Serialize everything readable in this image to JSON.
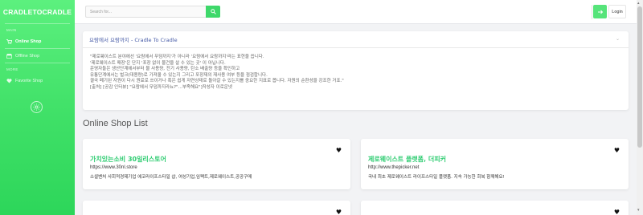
{
  "sidebar": {
    "brand": "CRADLETOCRADLE",
    "section_main": "Main",
    "items": [
      {
        "label": "Online Shop",
        "icon": "cart-icon"
      },
      {
        "label": "Offline Shop",
        "icon": "store-icon"
      }
    ],
    "section_more": "More",
    "extra_items": [
      {
        "label": "Favorite Shop",
        "icon": "heart-icon"
      }
    ]
  },
  "topbar": {
    "search_placeholder": "Search for...",
    "login_label": "Login"
  },
  "info_card": {
    "title": "요람에서 요람까지 - Cradle To Cradle",
    "lines": [
      "\"제로웨이스트 분야에선 '요람에서 무덤까지'가 아니라 '요람에서 요람까지'라는 표현을 씁니다.",
      "'제로웨이스트 매장'은 단지 '포장 없이 물건을 살 수 있는 곳' 이 아닙니다.",
      "운영자들은 생산단계에서부터 물 사용량, 전기 사용량, 탄소 배출량 등을 확인하고",
      "유통단계에서는 벌크(대용량)로 가져올 수 있는지 그리고 포장재의 재사용 여부 등을 점검합니다.",
      "결국 폐기된 자원이 다시 원료로 쓰이거나 혹은 쉽게 자연상태로 돌아갈 수 있는지를 중요한 지표로 봅니다. 자원의 순환성을 강조한 거죠.\"",
      "[출처] [공감 인터뷰] \"요람에서 무덤까지라뇨?\"...부족해요\"]작성자 이로운넷"
    ]
  },
  "list": {
    "title": "Online Shop List",
    "shops": [
      {
        "name": "가치있는소비 30일리스토어",
        "url": "https://www.30nl.store",
        "desc": "소셜벤처 사회적경제기업 에코라이프스타일 샵, 여성기업,임팩트,제로웨이스트,공공구매"
      },
      {
        "name": "제로웨이스트 플랫폼, 더피커",
        "url": "http://www.thepicker.net",
        "desc": "국내 최초 제로웨이스트 라이프스타일 플랫폼. 지속 가능한 회복 함께해요!"
      },
      {
        "name": "",
        "url": "",
        "desc": ""
      },
      {
        "name": "",
        "url": "",
        "desc": ""
      }
    ]
  },
  "colors": {
    "accent": "#3ed86a",
    "brand_green": "#2ecc71",
    "info_title": "#4a5ea8"
  }
}
